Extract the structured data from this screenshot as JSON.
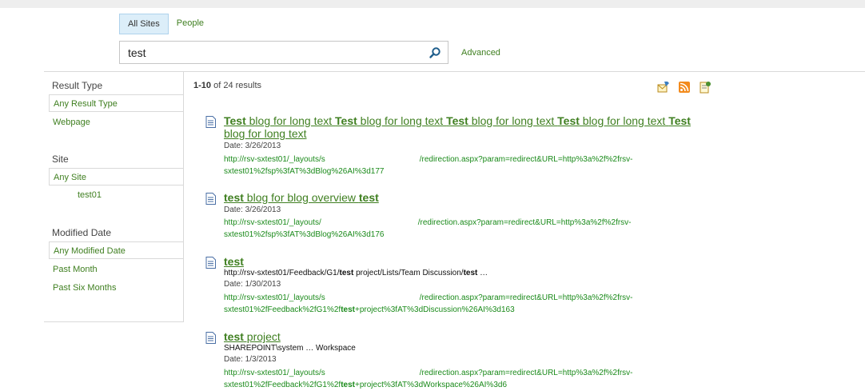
{
  "scope_tabs": {
    "all_sites": "All Sites",
    "people": "People"
  },
  "search": {
    "value": "test"
  },
  "advanced_label": "Advanced",
  "refiners": {
    "result_type": {
      "heading": "Result Type",
      "items": [
        "Any Result Type",
        "Webpage"
      ]
    },
    "site": {
      "heading": "Site",
      "items": [
        "Any Site",
        "test01"
      ]
    },
    "modified_date": {
      "heading": "Modified Date",
      "items": [
        "Any Modified Date",
        "Past Month",
        "Past Six Months"
      ]
    }
  },
  "results_summary": {
    "range": "1-10",
    "rest": "of 24 results"
  },
  "header_icons": [
    "alert-icon",
    "rss-icon",
    "search-settings-icon"
  ],
  "results": [
    {
      "title_parts": [
        {
          "t": "Test",
          "b": true
        },
        {
          "t": " blog for long text ",
          "b": false
        },
        {
          "t": "Test",
          "b": true
        },
        {
          "t": " blog for long text ",
          "b": false
        },
        {
          "t": "Test",
          "b": true
        },
        {
          "t": " blog for long text ",
          "b": false
        },
        {
          "t": "Test",
          "b": true
        },
        {
          "t": " blog for long text ",
          "b": false
        },
        {
          "t": "Test",
          "b": true
        },
        {
          "t": " blog for long text",
          "b": false
        }
      ],
      "date": "Date: 3/26/2013",
      "url_left": "http://rsv-sxtest01/_layouts/s",
      "url_right": "/redirection.aspx?param=redirect&URL=http%3a%2f%2frsv-",
      "url_line2": "sxtest01%2fsp%3fAT%3dBlog%26AI%3d177"
    },
    {
      "title_parts": [
        {
          "t": "test",
          "b": true
        },
        {
          "t": " blog for blog overview ",
          "b": false
        },
        {
          "t": "test",
          "b": true
        }
      ],
      "date": "Date: 3/26/2013",
      "url_left": "http://rsv-sxtest01/_layouts/",
      "url_right": "/redirection.aspx?param=redirect&URL=http%3a%2f%2frsv-",
      "url_line2": "sxtest01%2fsp%3fAT%3dBlog%26AI%3d176"
    },
    {
      "title_parts": [
        {
          "t": "test",
          "b": true
        }
      ],
      "snippet_parts": [
        {
          "t": "http://rsv-sxtest01/Feedback/G1/",
          "b": false
        },
        {
          "t": "test",
          "b": true
        },
        {
          "t": " project/Lists/Team Discussion/",
          "b": false
        },
        {
          "t": "test",
          "b": true
        },
        {
          "t": " …",
          "b": false
        }
      ],
      "date": "Date: 1/30/2013",
      "url_left": "http://rsv-sxtest01/_layouts/s",
      "url_right": "/redirection.aspx?param=redirect&URL=http%3a%2f%2frsv-",
      "url_line2_parts": [
        {
          "t": "sxtest01%2fFeedback%2fG1%2f",
          "b": false
        },
        {
          "t": "test",
          "b": true
        },
        {
          "t": "+project%3fAT%3dDiscussion%26AI%3d163",
          "b": false
        }
      ]
    },
    {
      "title_parts": [
        {
          "t": "test",
          "b": true
        },
        {
          "t": " project",
          "b": false
        }
      ],
      "snippet_parts": [
        {
          "t": "SHAREPOINT\\system … Workspace",
          "b": false
        }
      ],
      "date": "Date: 1/3/2013",
      "url_left": "http://rsv-sxtest01/_layouts/s",
      "url_right": "/redirection.aspx?param=redirect&URL=http%3a%2f%2frsv-",
      "url_line2_parts": [
        {
          "t": "sxtest01%2fFeedback%2fG1%2f",
          "b": false
        },
        {
          "t": "test",
          "b": true
        },
        {
          "t": "+project%3fAT%3dWorkspace%26AI%3d6",
          "b": false
        }
      ]
    }
  ],
  "colors": {
    "link_green": "#3f7f20",
    "url_green": "#1a8a1a",
    "tab_active_bg": "#dceef9"
  }
}
